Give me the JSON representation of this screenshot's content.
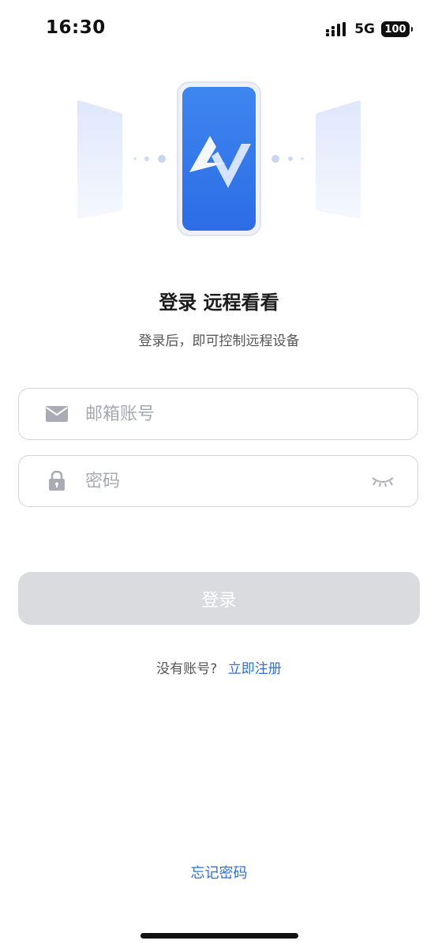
{
  "status_bar": {
    "time": "16:30",
    "network": "5G",
    "battery": "100"
  },
  "header": {
    "title": "登录 远程看看",
    "subtitle": "登录后，即可控制远程设备"
  },
  "form": {
    "email_placeholder": "邮箱账号",
    "password_placeholder": "密码",
    "email_value": "",
    "password_value": ""
  },
  "actions": {
    "login_label": "登录",
    "no_account_prompt": "没有账号?",
    "register_label": "立即注册",
    "forgot_label": "忘记密码"
  },
  "icons": {
    "email": "mail-icon",
    "password": "lock-icon",
    "toggle": "eye-closed-icon",
    "logo": "av-logo-icon"
  },
  "colors": {
    "accent": "#2f6fd8",
    "button_disabled": "#d9dbdf",
    "phone_gradient_top": "#3f86ef",
    "phone_gradient_bottom": "#2c6ce6"
  }
}
